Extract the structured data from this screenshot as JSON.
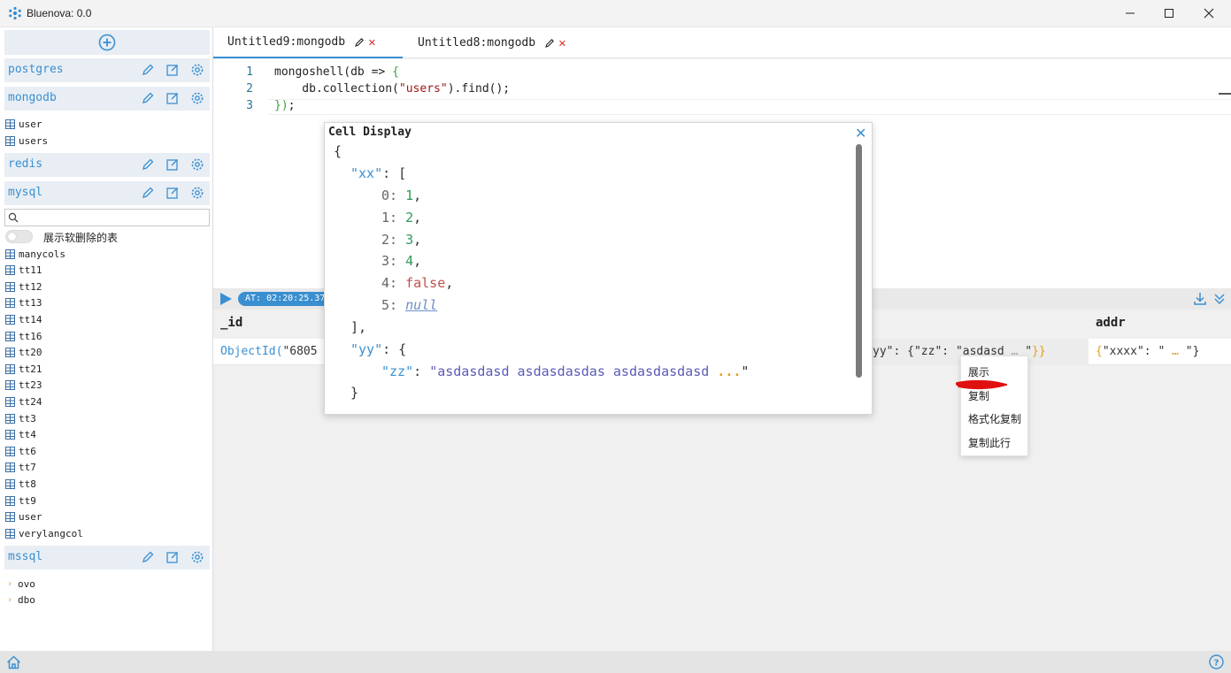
{
  "window": {
    "title": "Bluenova: 0.0"
  },
  "sidebar": {
    "connections": [
      {
        "name": "postgres"
      },
      {
        "name": "mongodb"
      },
      {
        "name": "redis"
      },
      {
        "name": "mysql"
      },
      {
        "name": "mssql"
      }
    ],
    "mongodb_tables": [
      "user",
      "users"
    ],
    "mysql_search_placeholder": "",
    "mysql_toggle_label": "展示软删除的表",
    "mysql_tables": [
      "manycols",
      "tt11",
      "tt12",
      "tt13",
      "tt14",
      "tt16",
      "tt20",
      "tt21",
      "tt23",
      "tt24",
      "tt3",
      "tt4",
      "tt6",
      "tt7",
      "tt8",
      "tt9",
      "user",
      "verylangcol"
    ],
    "mssql_schemas": [
      "ovo",
      "dbo"
    ]
  },
  "tabs": [
    {
      "label": "Untitled9:mongodb",
      "active": true
    },
    {
      "label": "Untitled8:mongodb",
      "active": false
    }
  ],
  "editor": {
    "line_numbers": [
      "1",
      "2",
      "3"
    ],
    "line1_a": "mongoshell(db => ",
    "line1_b": "{",
    "line2_a": "    db.collection(",
    "line2_str": "\"users\"",
    "line2_b": ").find();",
    "line3_a": "})",
    "line3_b": ";"
  },
  "results": {
    "time_badge": "AT: 02:20:25.37",
    "columns": [
      "_id",
      "addr"
    ],
    "row": {
      "id_prefix": "ObjectId(",
      "id_value": "\"6805",
      "mid_cell_a": "yy\"",
      "mid_cell_b": ": {",
      "mid_cell_c": "\"zz\"",
      "mid_cell_d": ": ",
      "mid_cell_e": "\"asdasd",
      "mid_cell_f": " … ",
      "mid_cell_g": "\"",
      "mid_cell_h": "}}",
      "addr_a": "{",
      "addr_b": "\"xxxx\"",
      "addr_c": ": \"",
      "addr_d": " … ",
      "addr_e": "\"}"
    }
  },
  "cell_display": {
    "title": "Cell Display",
    "open_brace": "{",
    "xx_key": "\"xx\"",
    "xx_open": ": [",
    "items": [
      {
        "idx": "0:",
        "val": "1",
        "kind": "num"
      },
      {
        "idx": "1:",
        "val": "2",
        "kind": "num"
      },
      {
        "idx": "2:",
        "val": "3",
        "kind": "num"
      },
      {
        "idx": "3:",
        "val": "4",
        "kind": "num"
      },
      {
        "idx": "4:",
        "val": "false",
        "kind": "bool"
      },
      {
        "idx": "5:",
        "val": "null",
        "kind": "null"
      }
    ],
    "xx_close": "],",
    "yy_key": "\"yy\"",
    "yy_open": ": {",
    "zz_key": "\"zz\"",
    "zz_colon": ": ",
    "zz_value": "\"asdasdasd asdasdasdas asdasdasdasd",
    "zz_ellipsis": "...",
    "zz_end": "\"",
    "inner_close": "}",
    "outer_close": "}"
  },
  "context_menu": {
    "items": [
      "展示",
      "复制",
      "格式化复制",
      "复制此行"
    ]
  },
  "colors": {
    "accent": "#3a8fd1",
    "close_red": "#e03030",
    "annotation_red": "#e01010"
  }
}
